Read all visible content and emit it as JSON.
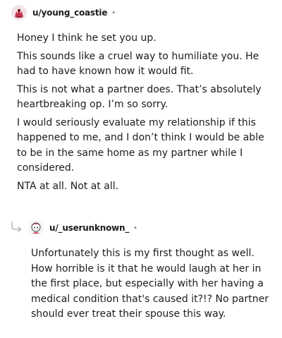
{
  "comments": [
    {
      "username": "u/young_coastie",
      "separator": "•",
      "paragraphs": [
        "Honey I think he set you up.",
        "This sounds like a cruel way to humiliate you. He had to have known how it would fit.",
        "This is not what a partner does. That’s absolutely heartbreaking op. I’m so sorry.",
        "I would seriously evaluate my relationship if this happened to me, and I don’t think I would be able to be in the same home as my partner while I considered.",
        "NTA at all. Not at all."
      ]
    },
    {
      "username": "u/_userunknown_",
      "separator": "•",
      "paragraphs": [
        "Unfortunately this is my first thought as well. How horrible is it that he would laugh at her in the first place, but especially with her having a medical condition that's caused it?!? No partner should ever treat their spouse this way."
      ]
    }
  ],
  "icons": {
    "avatar_1": "snoo-avatar-icon",
    "avatar_2": "snoo-avatar-icon",
    "reply_thread": "reply-arrow-icon"
  },
  "colors": {
    "text": "#1c1c1c",
    "muted": "#7c7c7c",
    "avatar1_accent": "#c2334d",
    "avatar2_accent": "#d23c5a"
  }
}
